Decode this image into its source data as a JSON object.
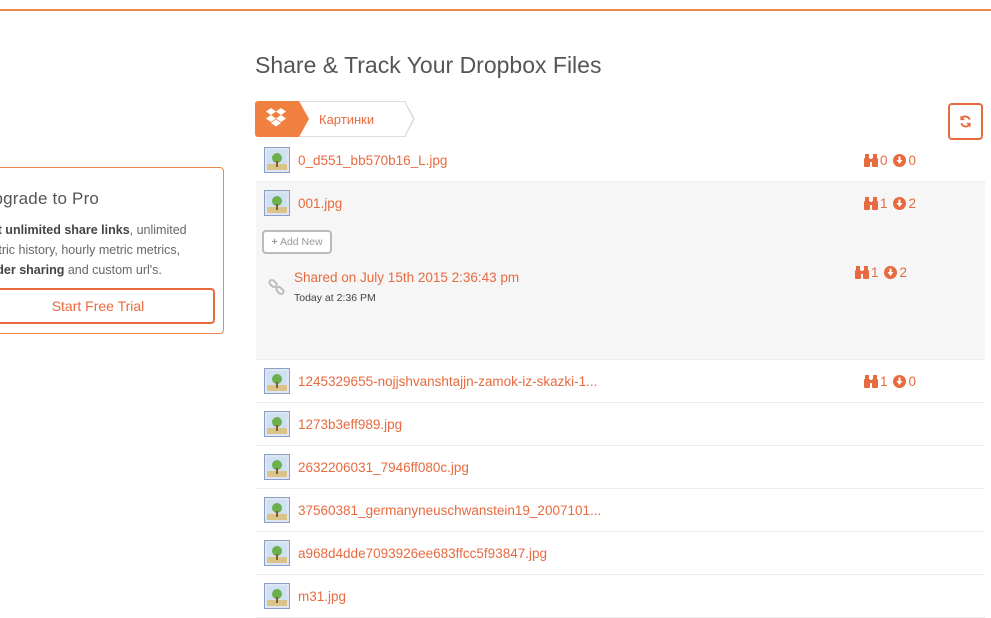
{
  "upgrade": {
    "title": "Upgrade to Pro",
    "line1_strong": "Get unlimited share links",
    "line1_rest": ", unlimited",
    "line2": "metric history, hourly metric metrics,",
    "line3_strong": "folder sharing",
    "line3_rest": " and custom url's.",
    "button_label": "Start Free Trial"
  },
  "page": {
    "title": "Share & Track Your Dropbox Files"
  },
  "breadcrumb": {
    "home_icon": "dropbox-icon",
    "current": "Картинки"
  },
  "toolbar": {
    "refresh_icon": "refresh-icon"
  },
  "files": [
    {
      "name": "0_d551_bb570b16_L.jpg",
      "views": "0",
      "downloads": "0"
    },
    {
      "name": "001.jpg",
      "views": "1",
      "downloads": "2"
    },
    {
      "name": "1245329655-nojjshvanshtajjn-zamok-iz-skazki-1...",
      "views": "1",
      "downloads": "0"
    },
    {
      "name": "1273b3eff989.jpg"
    },
    {
      "name": "2632206031_7946ff080c.jpg"
    },
    {
      "name": "37560381_germanyneuschwanstein19_2007101..."
    },
    {
      "name": "a968d4dde7093926ee683ffcc5f93847.jpg"
    },
    {
      "name": "m31.jpg"
    }
  ],
  "expanded": {
    "add_new_label": "Add New",
    "share": {
      "title": "Shared on July 15th 2015 2:36:43 pm",
      "time": "Today at 2:36 PM",
      "views": "1",
      "downloads": "2"
    }
  },
  "colors": {
    "accent": "#e86a3f",
    "accent_bg": "#f08040",
    "row_highlight": "#f6f6f6"
  }
}
